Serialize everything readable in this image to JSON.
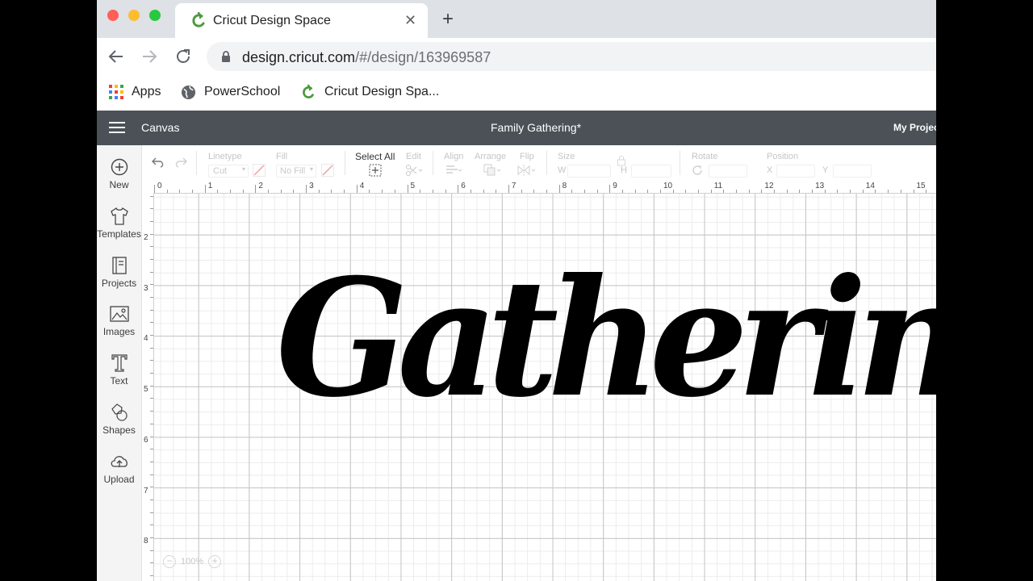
{
  "browser": {
    "tab_title": "Cricut Design Space",
    "tab_close": "✕",
    "new_tab": "+",
    "url_host": "design.cricut.com",
    "url_path": "/#/design/163969587",
    "bookmarks": [
      {
        "label": "Apps",
        "icon": "apps-grid-icon"
      },
      {
        "label": "PowerSchool",
        "icon": "globe-icon"
      },
      {
        "label": "Cricut Design Spa...",
        "icon": "cricut-logo-icon"
      }
    ],
    "traffic_light_colors": [
      "#ff5f57",
      "#febc2e",
      "#28c840"
    ]
  },
  "header": {
    "canvas_label": "Canvas",
    "project_title": "Family Gathering*",
    "my_projects": "My Projects"
  },
  "sidebar": {
    "items": [
      {
        "label": "New",
        "icon": "plus-circle-icon"
      },
      {
        "label": "Templates",
        "icon": "tshirt-icon"
      },
      {
        "label": "Projects",
        "icon": "projects-icon"
      },
      {
        "label": "Images",
        "icon": "image-icon"
      },
      {
        "label": "Text",
        "icon": "text-t-icon"
      },
      {
        "label": "Shapes",
        "icon": "shapes-icon"
      },
      {
        "label": "Upload",
        "icon": "cloud-upload-icon"
      }
    ]
  },
  "toolbar": {
    "linetype_label": "Linetype",
    "linetype_value": "Cut",
    "fill_label": "Fill",
    "fill_value": "No Fill",
    "select_all": "Select All",
    "edit": "Edit",
    "align": "Align",
    "arrange": "Arrange",
    "flip": "Flip",
    "size": "Size",
    "size_w": "W",
    "size_h": "H",
    "rotate": "Rotate",
    "position": "Position",
    "pos_x": "X",
    "pos_y": "Y"
  },
  "ruler": {
    "top": [
      "0",
      "1",
      "2",
      "3",
      "4",
      "5",
      "6",
      "7",
      "8",
      "9",
      "10",
      "11",
      "12",
      "13",
      "14",
      "15"
    ],
    "left": [
      "2",
      "3",
      "4",
      "5",
      "6",
      "7",
      "8"
    ]
  },
  "canvas": {
    "design_text": "Gathering",
    "zoom": "100%",
    "zoom_out": "−",
    "zoom_in": "+"
  }
}
